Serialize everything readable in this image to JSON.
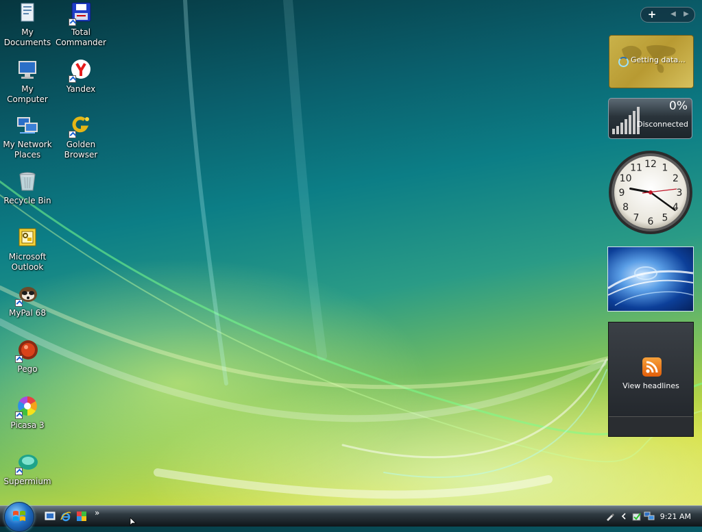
{
  "desktop": {
    "icons": [
      {
        "label": "My Documents",
        "icon": "my-documents-icon"
      },
      {
        "label": "Total Commander",
        "icon": "total-commander-icon"
      },
      {
        "label": "My Computer",
        "icon": "my-computer-icon"
      },
      {
        "label": "Yandex",
        "icon": "yandex-icon"
      },
      {
        "label": "My Network Places",
        "icon": "network-places-icon"
      },
      {
        "label": "Golden Browser",
        "icon": "golden-browser-icon"
      },
      {
        "label": "Recycle Bin",
        "icon": "recycle-bin-icon"
      },
      {
        "label": "Microsoft Outlook",
        "icon": "outlook-icon"
      },
      {
        "label": "MyPal 68",
        "icon": "mypal-icon"
      },
      {
        "label": "Pego",
        "icon": "pego-icon"
      },
      {
        "label": "Picasa 3",
        "icon": "picasa-icon"
      },
      {
        "label": "Supermium",
        "icon": "supermium-icon"
      }
    ]
  },
  "sidebar": {
    "add_label": "+",
    "prev_label": "◀",
    "next_label": "▶",
    "weather": {
      "status": "Getting data..."
    },
    "network_meter": {
      "percent": "0%",
      "status": "Disconnected"
    },
    "clock": {
      "numerals": [
        "12",
        "1",
        "2",
        "3",
        "4",
        "5",
        "6",
        "7",
        "8",
        "9",
        "10",
        "11"
      ],
      "time": "9:21"
    },
    "feed": {
      "label": "View headlines"
    }
  },
  "taskbar": {
    "chevron": "»",
    "clock": "9:21 AM"
  },
  "colors": {
    "accent": "#1e6fc6",
    "rss": "#e25e0a"
  }
}
